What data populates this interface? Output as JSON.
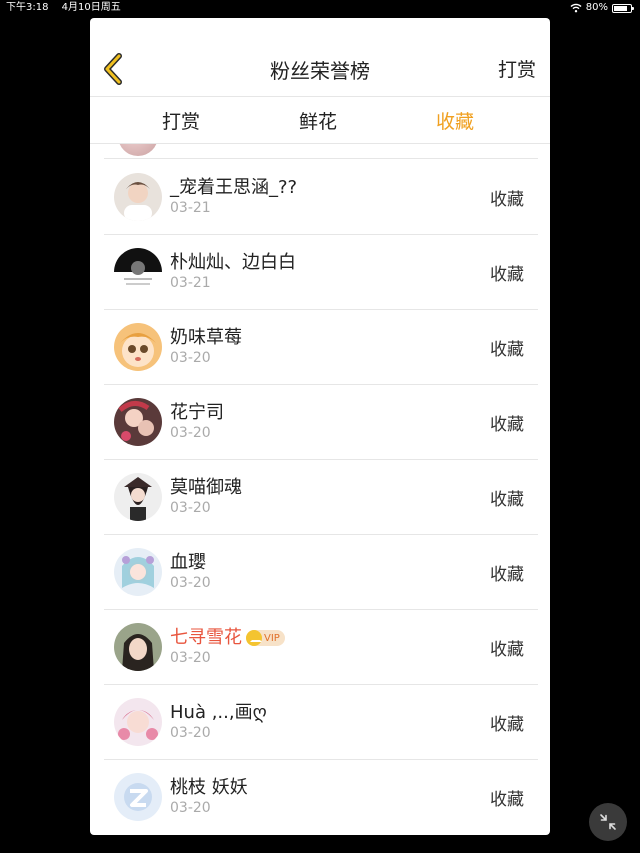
{
  "status_bar": {
    "time": "下午3:18",
    "date": "4月10日周五",
    "battery": "80%",
    "battery_level": 0.8
  },
  "nav": {
    "title": "粉丝荣誉榜",
    "action": "打赏",
    "back_icon": "chevron-left-icon",
    "accent_color": "#f0a020"
  },
  "tabs": [
    {
      "label": "打赏",
      "active": false
    },
    {
      "label": "鲜花",
      "active": false
    },
    {
      "label": "收藏",
      "active": true
    }
  ],
  "rows": [
    {
      "name": "_宠着王思涵_??",
      "date": "03-21",
      "action": "收藏",
      "vip": false
    },
    {
      "name": "朴灿灿、边白白",
      "date": "03-21",
      "action": "收藏",
      "vip": false
    },
    {
      "name": "奶味草莓",
      "date": "03-20",
      "action": "收藏",
      "vip": false
    },
    {
      "name": "花宁司",
      "date": "03-20",
      "action": "收藏",
      "vip": false
    },
    {
      "name": "莫喵御魂",
      "date": "03-20",
      "action": "收藏",
      "vip": false
    },
    {
      "name": "血瓔",
      "date": "03-20",
      "action": "收藏",
      "vip": false
    },
    {
      "name": "七寻雪花",
      "date": "03-20",
      "action": "收藏",
      "vip": true,
      "badge": "VIP"
    },
    {
      "name": "Huà ,..,画ღ",
      "date": "03-20",
      "action": "收藏",
      "vip": false
    },
    {
      "name": "桃枝 妖妖",
      "date": "03-20",
      "action": "收藏",
      "vip": false
    }
  ]
}
